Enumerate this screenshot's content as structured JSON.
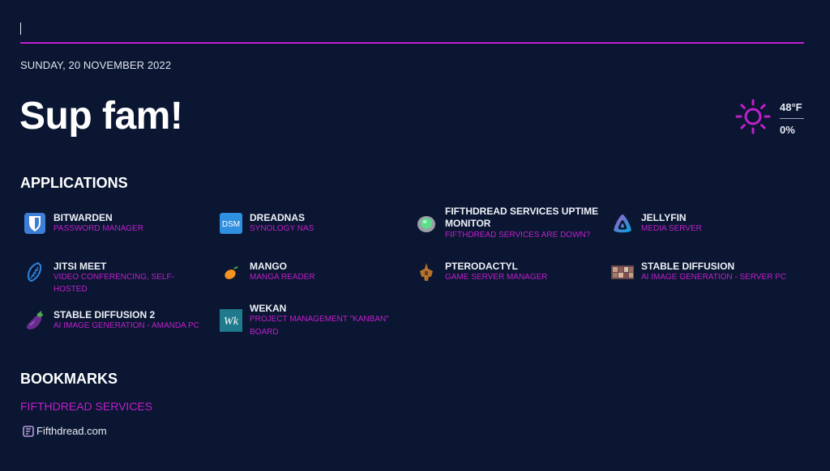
{
  "header": {
    "search_value": "",
    "date": "SUNDAY, 20 NOVEMBER 2022",
    "greeting": "Sup fam!"
  },
  "weather": {
    "icon": "sun-icon",
    "temperature": "48°F",
    "precipitation": "0%",
    "accent_color": "#c11fcc"
  },
  "applications": {
    "title": "APPLICATIONS",
    "items": [
      {
        "name": "Bitwarden",
        "description": "Password Manager",
        "icon": "bitwarden-icon"
      },
      {
        "name": "DreadNAS",
        "description": "Synology NAS",
        "icon": "dsm-icon",
        "icon_text": "DSM"
      },
      {
        "name": "Fifthdread Services Uptime Monitor",
        "description": "Fifthdread Services are down?",
        "icon": "uptime-kuma-icon"
      },
      {
        "name": "Jellyfin",
        "description": "Media Server",
        "icon": "jellyfin-icon"
      },
      {
        "name": "Jitsi Meet",
        "description": "Video Conferencing, Self-Hosted",
        "icon": "jitsi-icon"
      },
      {
        "name": "Mango",
        "description": "Manga Reader",
        "icon": "mango-icon"
      },
      {
        "name": "Pterodactyl",
        "description": "Game Server Manager",
        "icon": "pterodactyl-icon"
      },
      {
        "name": "Stable Diffusion",
        "description": "AI Image Generation - Server PC",
        "icon": "stable-diffusion-icon"
      },
      {
        "name": "Stable Diffusion 2",
        "description": "AI Image Generation - Amanda PC",
        "icon": "eggplant-icon"
      },
      {
        "name": "Wekan",
        "description": "Project Management \"Kanban\" Board",
        "icon": "wekan-icon",
        "icon_text": "Wk"
      }
    ]
  },
  "bookmarks": {
    "title": "BOOKMARKS",
    "groups": [
      {
        "name": "Fifthdread Services",
        "links": [
          {
            "label": "Fifthdread.com",
            "icon": "fifthdread-icon"
          }
        ]
      }
    ]
  },
  "colors": {
    "background": "#0a1632",
    "accent": "#c11fcc",
    "text": "#ffffff"
  }
}
